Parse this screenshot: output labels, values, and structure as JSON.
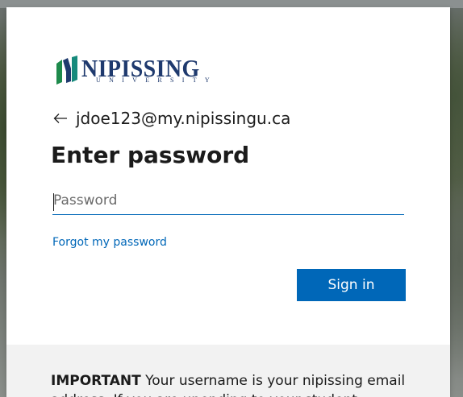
{
  "logo": {
    "name": "NIPISSING",
    "subtitle": "UNIVERSITY",
    "colors": {
      "green": "#1e8a4c",
      "navy": "#1f3a6e",
      "teal": "#168a7c"
    }
  },
  "identity": {
    "back_icon": "arrow-left-icon",
    "email": "jdoe123@my.nipissingu.ca"
  },
  "title": "Enter password",
  "password_field": {
    "placeholder": "Password",
    "value": ""
  },
  "forgot_link": "Forgot my password",
  "signin_button": "Sign in",
  "notice": {
    "label": "IMPORTANT",
    "text": " Your username is your nipissing email address. If you are unending to your student... "
  },
  "colors": {
    "accent": "#0067b8",
    "text": "#1b1b1b",
    "notice_bg": "#f2f2f2"
  }
}
